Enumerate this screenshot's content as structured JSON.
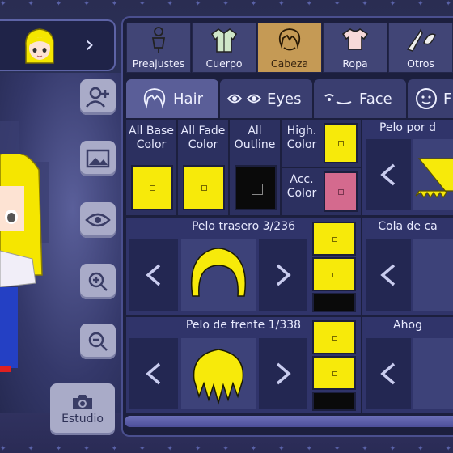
{
  "categories": [
    {
      "label": "Preajustes",
      "icon": "mannequin-icon"
    },
    {
      "label": "Cuerpo",
      "icon": "jacket-icon"
    },
    {
      "label": "Cabeza",
      "icon": "hair-icon"
    },
    {
      "label": "Ropa",
      "icon": "shirt-icon"
    },
    {
      "label": "Otros",
      "icon": "swords-icon"
    }
  ],
  "sub_tabs": [
    {
      "label": "Hair",
      "icon": "hair-outline-icon"
    },
    {
      "label": "Eyes",
      "icon": "eyes-icon"
    },
    {
      "label": "Face",
      "icon": "face-icon"
    },
    {
      "label": "F",
      "icon": "face-round-icon"
    }
  ],
  "color_controls": {
    "all_base": "All Base Color",
    "all_fade": "All Fade Color",
    "all_outline": "All Outline",
    "high": "High. Color",
    "acc": "Acc. Color"
  },
  "rows": {
    "pelo_por": "Pelo por d",
    "pelo_trasero": "Pelo trasero 3/236",
    "cola": "Cola de ca",
    "pelo_frente": "Pelo de frente 1/338",
    "ahog": "Ahog"
  },
  "studio_label": "Estudio",
  "colors": {
    "yellow": "#f7ea0a",
    "pink": "#d46a8e",
    "black": "#0a0a0a",
    "active_tab": "#c59a55"
  }
}
